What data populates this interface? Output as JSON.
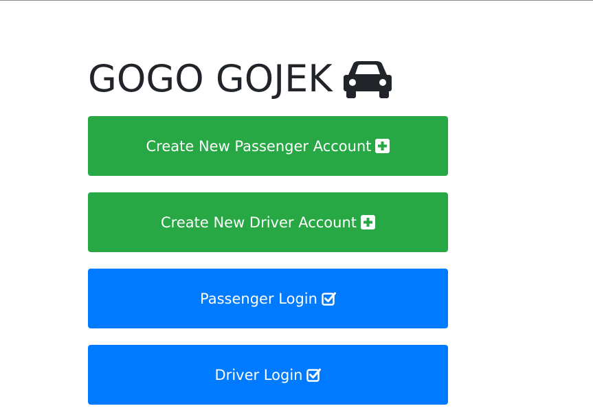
{
  "header": {
    "title": "GOGO GOJEK",
    "title_icon": "car-icon"
  },
  "actions": [
    {
      "label": "Create New Passenger Account",
      "icon": "plus-square-icon",
      "color": "#28a745"
    },
    {
      "label": "Create New Driver Account",
      "icon": "plus-square-icon",
      "color": "#28a745"
    },
    {
      "label": "Passenger Login",
      "icon": "check-square-icon",
      "color": "#007bff"
    },
    {
      "label": "Driver Login",
      "icon": "check-square-icon",
      "color": "#007bff"
    }
  ]
}
